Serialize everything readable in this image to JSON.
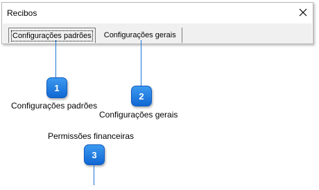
{
  "window": {
    "title": "Recibos",
    "close_icon": "close-icon"
  },
  "tabs": [
    {
      "label": "Configurações padrões",
      "active": true
    },
    {
      "label": "Configurações gerais",
      "active": false
    }
  ],
  "callouts": [
    {
      "number": "1",
      "text": "Configurações padrões"
    },
    {
      "number": "2",
      "text": "Configurações gerais"
    },
    {
      "number": "3",
      "text": "Permissões financeiras"
    }
  ],
  "colors": {
    "badge": "#1c74d9",
    "connector": "#1c74d9"
  }
}
